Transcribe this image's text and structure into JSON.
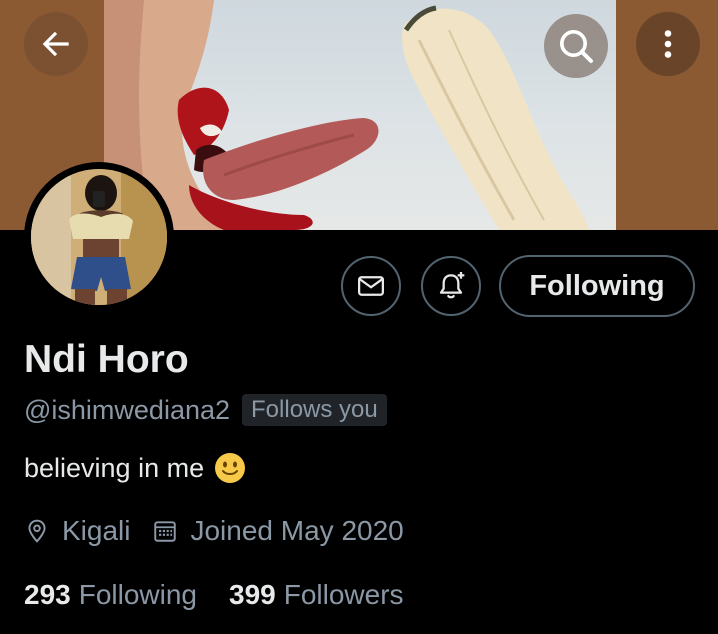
{
  "colors": {
    "background": "#000000",
    "text_primary": "#e7e9ea",
    "text_secondary": "#8b98a5",
    "banner_sides": "#8b5a33",
    "button_border": "#536471"
  },
  "header": {
    "back_icon": "arrow-left-icon",
    "search_icon": "search-icon",
    "more_icon": "more-vertical-icon"
  },
  "profile": {
    "display_name": "Ndi Horo",
    "handle": "@ishimwediana2",
    "follows_you_badge": "Follows you",
    "bio": "believing in me",
    "bio_emoji": "slightly-smiling-face",
    "location": "Kigali",
    "joined": "Joined May 2020",
    "location_icon": "location-pin-icon",
    "calendar_icon": "calendar-icon"
  },
  "actions": {
    "message_icon": "mail-icon",
    "notify_icon": "bell-plus-icon",
    "following_label": "Following"
  },
  "stats": {
    "following_count": "293",
    "following_label": "Following",
    "followers_count": "399",
    "followers_label": "Followers"
  }
}
